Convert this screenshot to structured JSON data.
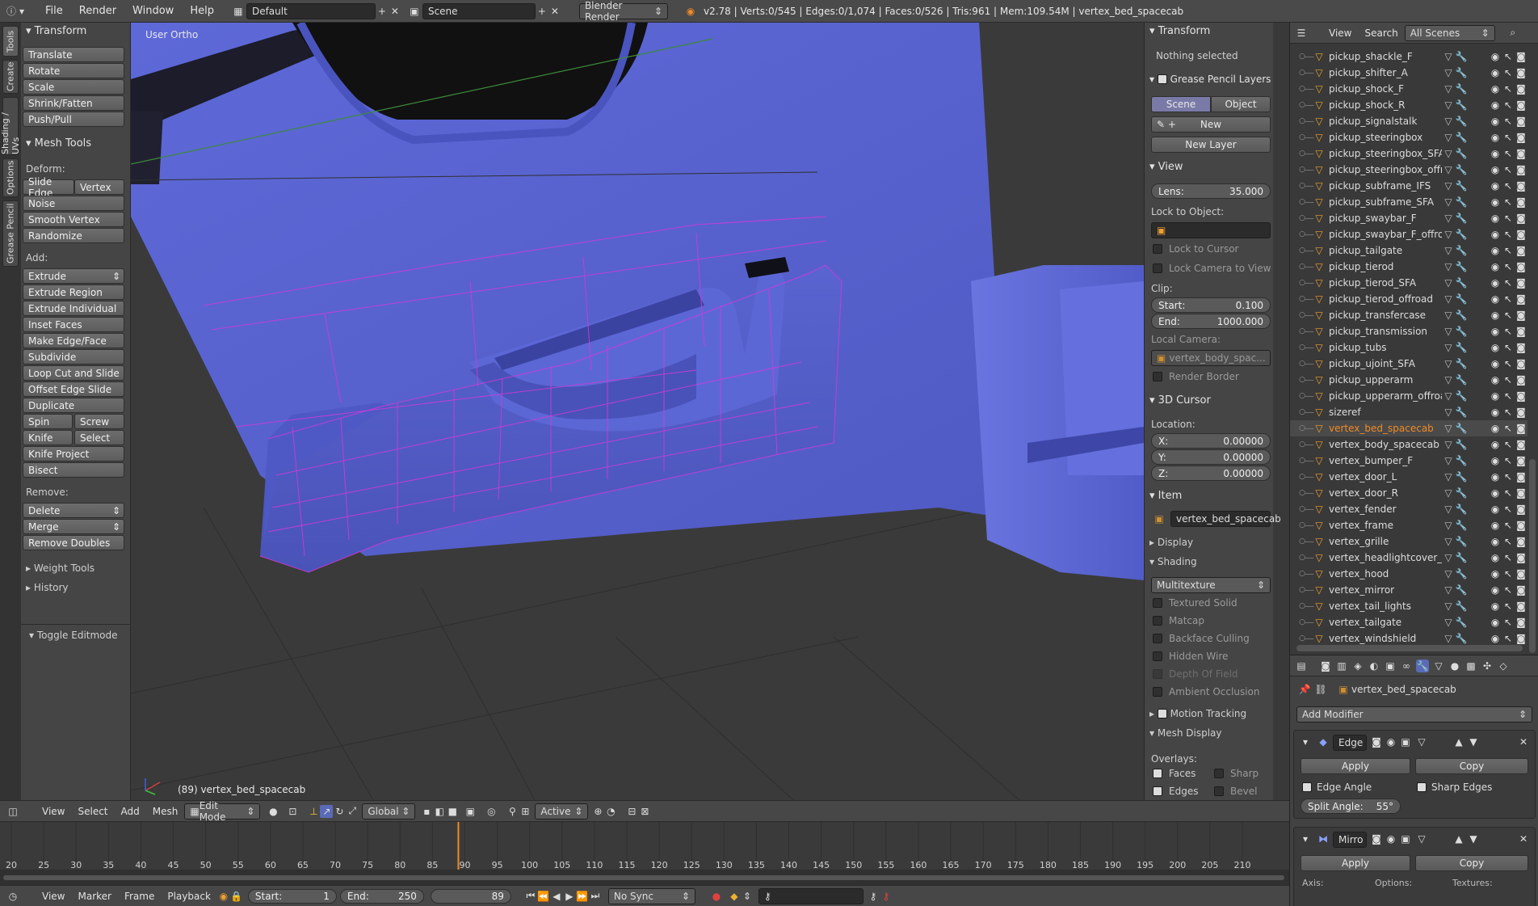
{
  "topbar": {
    "menus": [
      "File",
      "Render",
      "Window",
      "Help"
    ],
    "layout": "Default",
    "scene": "Scene",
    "engine": "Blender Render",
    "stats": "v2.78 | Verts:0/545 | Edges:0/1,074 | Faces:0/526 | Tris:961 | Mem:109.54M | vertex_bed_spacecab"
  },
  "left_tabs": [
    "Tools",
    "Create",
    "Shading / UVs",
    "Options",
    "Grease Pencil"
  ],
  "toolshelf": {
    "transform_header": "Transform",
    "transform": [
      "Translate",
      "Rotate",
      "Scale",
      "Shrink/Fatten",
      "Push/Pull"
    ],
    "mesh_tools_header": "Mesh Tools",
    "deform_label": "Deform:",
    "slide_edge": "Slide Edge",
    "vertex": "Vertex",
    "noise": "Noise",
    "smooth_vertex": "Smooth Vertex",
    "randomize": "Randomize",
    "add_label": "Add:",
    "extrude": "Extrude",
    "add_items": [
      "Extrude Region",
      "Extrude Individual",
      "Inset Faces",
      "Make Edge/Face",
      "Subdivide",
      "Loop Cut and Slide",
      "Offset Edge Slide",
      "Duplicate"
    ],
    "spin": "Spin",
    "screw": "Screw",
    "knife": "Knife",
    "select": "Select",
    "knife_project": "Knife Project",
    "bisect": "Bisect",
    "remove_label": "Remove:",
    "delete": "Delete",
    "merge": "Merge",
    "remove_doubles": "Remove Doubles",
    "weight_tools": "Weight Tools",
    "history": "History",
    "toggle_editmode": "Toggle Editmode"
  },
  "viewport": {
    "view_name": "User Ortho",
    "object_label": "(89) vertex_bed_spacecab"
  },
  "npanel": {
    "transform": "Transform",
    "nothing_selected": "Nothing selected",
    "grease_pencil_layers": "Grease Pencil Layers",
    "scene_tab": "Scene",
    "object_tab": "Object",
    "new": "New",
    "new_layer": "New Layer",
    "view": "View",
    "lens_label": "Lens:",
    "lens_value": "35.000",
    "lock_to_object": "Lock to Object:",
    "lock_to_cursor": "Lock to Cursor",
    "lock_camera": "Lock Camera to View",
    "clip": "Clip:",
    "start_label": "Start:",
    "start_value": "0.100",
    "end_label": "End:",
    "end_value": "1000.000",
    "local_camera": "Local Camera:",
    "camera_value": "vertex_body_spac...",
    "render_border": "Render Border",
    "cursor_3d": "3D Cursor",
    "location": "Location:",
    "x_label": "X:",
    "x_value": "0.00000",
    "y_label": "Y:",
    "y_value": "0.00000",
    "z_label": "Z:",
    "z_value": "0.00000",
    "item": "Item",
    "item_name": "vertex_bed_spacecab",
    "display": "Display",
    "shading": "Shading",
    "shading_mode": "Multitexture",
    "shading_opts": [
      "Textured Solid",
      "Matcap",
      "Backface Culling",
      "Hidden Wire",
      "Depth Of Field",
      "Ambient Occlusion"
    ],
    "motion_tracking": "Motion Tracking",
    "mesh_display": "Mesh Display",
    "overlays": "Overlays:",
    "faces": "Faces",
    "sharp": "Sharp",
    "edges": "Edges",
    "bevel": "Bevel"
  },
  "outliner": {
    "view": "View",
    "search": "Search",
    "scope": "All Scenes",
    "items": [
      "pickup_shackle_F",
      "pickup_shifter_A",
      "pickup_shock_F",
      "pickup_shock_R",
      "pickup_signalstalk",
      "pickup_steeringbox",
      "pickup_steeringbox_SFA",
      "pickup_steeringbox_offroad",
      "pickup_subframe_IFS",
      "pickup_subframe_SFA",
      "pickup_swaybar_F",
      "pickup_swaybar_F_offroad",
      "pickup_tailgate",
      "pickup_tierod",
      "pickup_tierod_SFA",
      "pickup_tierod_offroad",
      "pickup_transfercase",
      "pickup_transmission",
      "pickup_tubs",
      "pickup_ujoint_SFA",
      "pickup_upperarm",
      "pickup_upperarm_offroad",
      "sizeref",
      "vertex_bed_spacecab",
      "vertex_body_spacecab",
      "vertex_bumper_F",
      "vertex_door_L",
      "vertex_door_R",
      "vertex_fender",
      "vertex_frame",
      "vertex_grille",
      "vertex_headlightcover_R",
      "vertex_hood",
      "vertex_mirror",
      "vertex_tail_lights",
      "vertex_tailgate",
      "vertex_windshield"
    ],
    "active_index": 23
  },
  "props": {
    "object_name": "vertex_bed_spacecab",
    "add_modifier": "Add Modifier",
    "mod1_name": "Edge",
    "apply": "Apply",
    "copy": "Copy",
    "edge_angle": "Edge Angle",
    "sharp_edges": "Sharp Edges",
    "split_angle_label": "Split Angle:",
    "split_angle_value": "55°",
    "mod2_name": "Mirro",
    "axis": "Axis:",
    "options": "Options:",
    "textures": "Textures:"
  },
  "vpheader": {
    "view": "View",
    "select": "Select",
    "add": "Add",
    "mesh": "Mesh",
    "mode": "Edit Mode",
    "orientation": "Global",
    "pivot": "Active"
  },
  "timeline": {
    "ticks": [
      "20",
      "25",
      "30",
      "35",
      "40",
      "45",
      "50",
      "55",
      "60",
      "65",
      "70",
      "75",
      "80",
      "85",
      "90",
      "95",
      "100",
      "105",
      "110",
      "115",
      "120",
      "125",
      "130",
      "135",
      "140",
      "145",
      "150",
      "155",
      "160",
      "165",
      "170",
      "175",
      "180",
      "185",
      "190",
      "195",
      "200",
      "205",
      "210"
    ],
    "current_frame": 89,
    "range_start": 20,
    "range_end": 213
  },
  "tlfooter": {
    "view": "View",
    "marker": "Marker",
    "frame": "Frame",
    "playback": "Playback",
    "start_label": "Start:",
    "start_value": "1",
    "end_label": "End:",
    "end_value": "250",
    "current": "89",
    "sync": "No Sync"
  },
  "colors": {
    "mesh": "#5c66d6",
    "wire": "#d23ad9",
    "active": "#f08a24"
  }
}
